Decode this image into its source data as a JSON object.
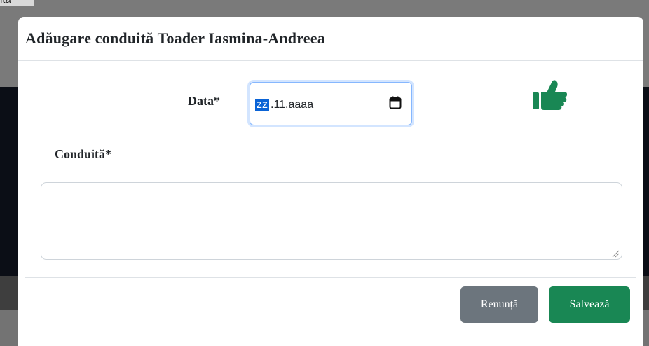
{
  "background": {
    "tab_text": "ita"
  },
  "modal": {
    "title": "Adăugare conduită Toader Iasmina-Andreea",
    "date_field": {
      "label": "Data*",
      "day_segment": "zz",
      "rest_segment": ".11.aaaa",
      "calendar_icon": "calendar-icon"
    },
    "status_icon": "thumbs-up-icon",
    "status_color": "#198754",
    "conduct_field": {
      "label": "Conduită*",
      "value": ""
    },
    "buttons": {
      "cancel": "Renunță",
      "save": "Salvează"
    }
  }
}
